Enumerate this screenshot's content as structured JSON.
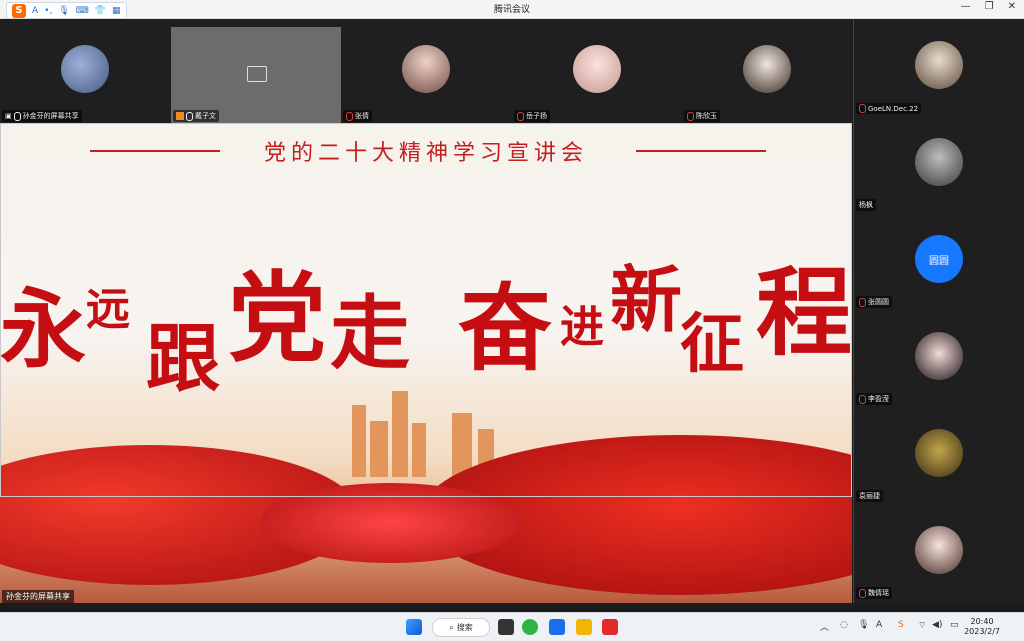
{
  "window": {
    "title": "腾讯会议"
  },
  "ime": {
    "logo": "S",
    "items": [
      "A",
      "•,",
      "mic",
      "kbd",
      "shirt",
      "grid"
    ]
  },
  "top_participants": [
    {
      "name": "孙金芬的屏幕共享",
      "avatar_color": "#6b7fae",
      "screen": true
    },
    {
      "name": "戴子文",
      "avatar_color": "",
      "locked": true
    },
    {
      "name": "张倩",
      "avatar_color": "#c8a59a"
    },
    {
      "name": "岳子扬",
      "avatar_color": "#e7c2c0"
    },
    {
      "name": "陈欣玉",
      "avatar_color": "#8b7563"
    }
  ],
  "side_participants": [
    {
      "name": "GoeLN.Dec.22",
      "avatar_color": "#a89482"
    },
    {
      "name": "杨枫",
      "avatar_color": "#8c8c8c"
    },
    {
      "name": "张圆圆",
      "avatar_text": "圆圆",
      "avatar_color": "#1677ff"
    },
    {
      "name": "李盈滢",
      "avatar_color": "#3a2f35"
    },
    {
      "name": "袁丽捷",
      "avatar_color": "#7d6a3a"
    },
    {
      "name": "魏倩瑶",
      "avatar_color": "#d9b7a5"
    }
  ],
  "share": {
    "label": "孙金芬的屏幕共享",
    "headline": "党的二十大精神学习宣讲会",
    "slogan": [
      "永",
      "远",
      "跟",
      "党",
      "走",
      "奋",
      "进",
      "新",
      "征",
      "程"
    ]
  },
  "taskbar": {
    "search": "搜索",
    "time": "20:40",
    "date": "2023/2/7"
  }
}
